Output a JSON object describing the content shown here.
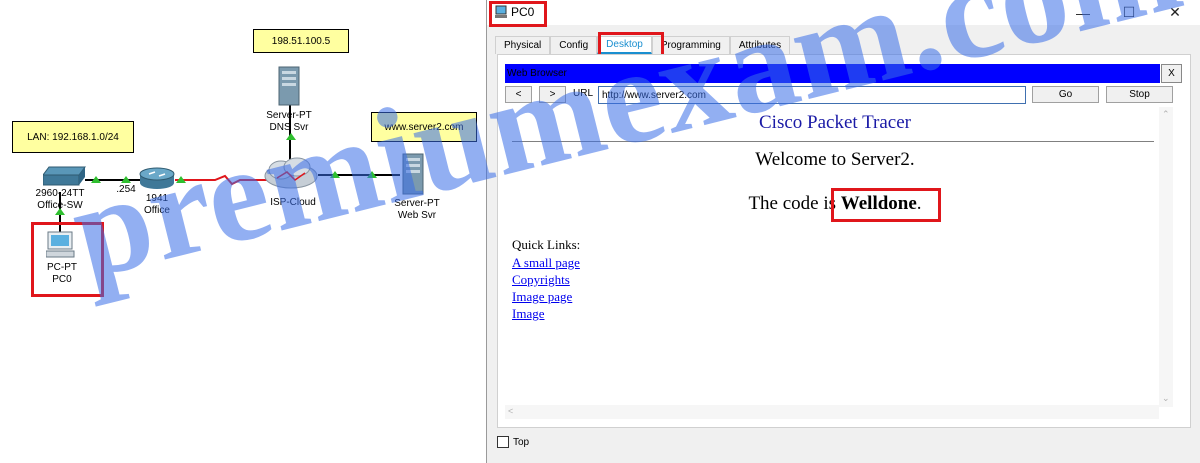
{
  "topology": {
    "notes": {
      "dns_ip": "198.51.100.5",
      "lan": "LAN: 192.168.1.0/24",
      "web": "www.server2.com"
    },
    "devices": {
      "dns_server": [
        "Server-PT",
        "DNS Svr"
      ],
      "switch": [
        "2960-24TT",
        "Office-SW"
      ],
      "router": [
        "1941",
        "Office"
      ],
      "router_ip": ".254",
      "cloud": "ISP-Cloud",
      "web_server": [
        "Server-PT",
        "Web Svr"
      ],
      "pc": [
        "PC-PT",
        "PC0"
      ]
    },
    "colors": {
      "link": "#000000",
      "serial": "#e0161b",
      "link_up": "#2fbf2f",
      "highlight": "#e0161b"
    }
  },
  "window": {
    "title": "PC0",
    "tabs": [
      "Physical",
      "Config",
      "Desktop",
      "Programming",
      "Attributes"
    ],
    "active_tab": "Desktop",
    "web_browser": {
      "bar_title": "Web Browser",
      "close": "X",
      "back": "<",
      "forward": ">",
      "url_label": "URL",
      "url": "http://www.server2.com",
      "go": "Go",
      "stop": "Stop"
    },
    "page": {
      "heading": "Cisco Packet Tracer",
      "welcome": "Welcome to Server2.",
      "code_prefix": "The code is ",
      "code_value": "Welldone",
      "code_suffix": ".",
      "quick_links_title": "Quick Links:",
      "links": [
        "A small page",
        "Copyrights",
        "Image page",
        "Image"
      ]
    },
    "top_checkbox": "Top"
  },
  "watermark": "premiumexam.com"
}
